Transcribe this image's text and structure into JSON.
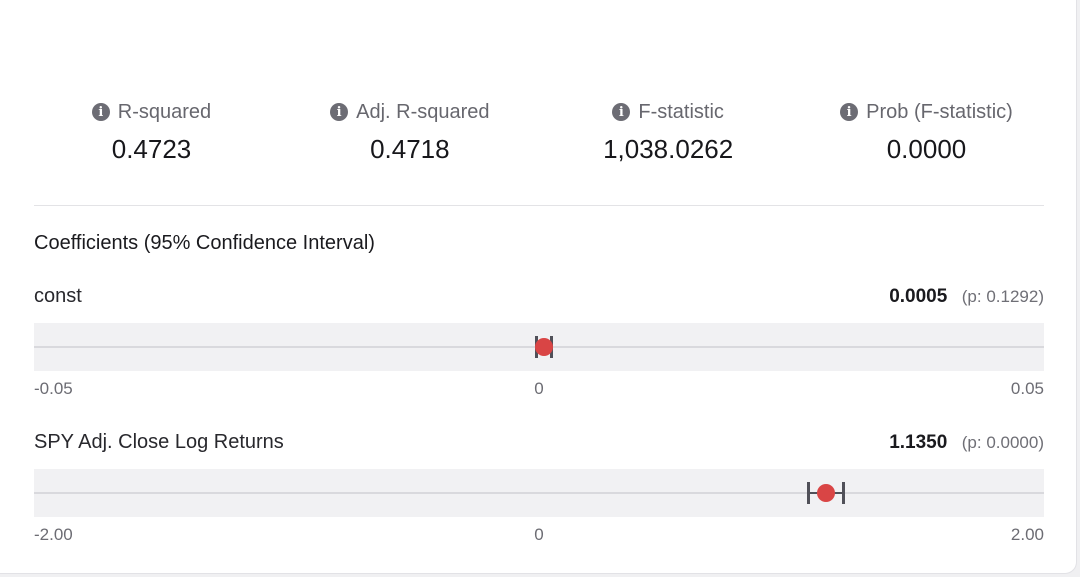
{
  "stats": [
    {
      "label": "R-squared",
      "value": "0.4723"
    },
    {
      "label": "Adj. R-squared",
      "value": "0.4718"
    },
    {
      "label": "F-statistic",
      "value": "1,038.0262"
    },
    {
      "label": "Prob (F-statistic)",
      "value": "0.0000"
    }
  ],
  "section_title": "Coefficients (95% Confidence Interval)",
  "coefficients": [
    {
      "name": "const",
      "value": "0.0005",
      "p_text": "(p: 0.1292)",
      "estimate": 0.0005,
      "ci_low": -0.0002,
      "ci_high": 0.0012,
      "axis_min": -0.05,
      "axis_max": 0.05,
      "tick_min": "-0.05",
      "tick_mid": "0",
      "tick_max": "0.05"
    },
    {
      "name": "SPY Adj. Close Log Returns",
      "value": "1.1350",
      "p_text": "(p: 0.0000)",
      "estimate": 1.135,
      "ci_low": 1.066,
      "ci_high": 1.204,
      "axis_min": -2.0,
      "axis_max": 2.0,
      "tick_min": "-2.00",
      "tick_mid": "0",
      "tick_max": "2.00"
    }
  ],
  "colors": {
    "point": "#d94545",
    "ci": "#505058",
    "track": "#f1f1f3"
  },
  "icons": {
    "stat_info": "info-icon"
  }
}
